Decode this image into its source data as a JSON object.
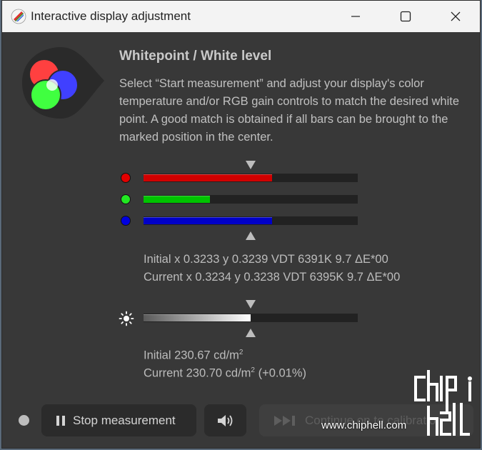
{
  "window": {
    "title": "Interactive display adjustment"
  },
  "content": {
    "heading": "Whitepoint / White level",
    "description": "Select “Start measurement” and adjust your display's color temperature and/or RGB gain controls to match the desired white point. A good match is obtained if all bars can be brought to the marked position in the center."
  },
  "rgb_bars": [
    {
      "name": "red",
      "color": "#d10000",
      "dot": "#e20000",
      "level": 0.6
    },
    {
      "name": "green",
      "color": "#00c400",
      "dot": "#22e822",
      "level": 0.31
    },
    {
      "name": "blue",
      "color": "#0000c8",
      "dot": "#0000e0",
      "level": 0.6
    }
  ],
  "whitepoint_readout": {
    "initial": "Initial x 0.3233 y 0.3239 VDT 6391K 9.7 ΔE*00",
    "current": "Current x 0.3234 y 0.3238 VDT 6395K 9.7 ΔE*00"
  },
  "brightness_bar": {
    "level": 0.5
  },
  "luminance_readout": {
    "initial_prefix": "Initial 230.67 cd/m",
    "initial_sup": "2",
    "current_prefix": "Current 230.70 cd/m",
    "current_sup": "2",
    "current_suffix": " (+0.01%)"
  },
  "buttons": {
    "stop_label": "Stop measurement",
    "continue_label": "Continue on to calibration"
  },
  "watermark": {
    "url": "www.chiphell.com"
  }
}
